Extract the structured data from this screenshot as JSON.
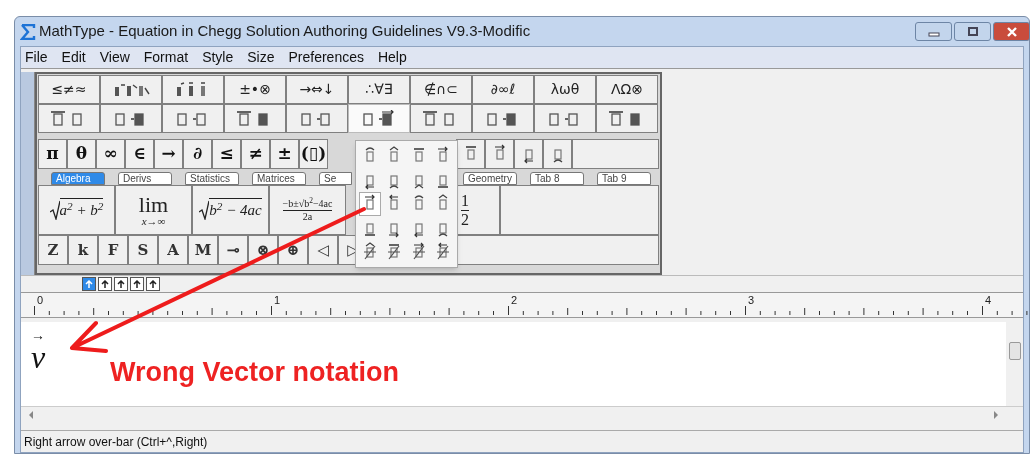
{
  "window": {
    "title": "MathType - Equation in Chegg Solution Authoring Guidelines V9.3-Modific"
  },
  "menu": [
    "File",
    "Edit",
    "View",
    "Format",
    "Style",
    "Size",
    "Preferences",
    "Help"
  ],
  "palette": {
    "row_1": [
      {
        "kind": "text",
        "text": "≤≠≈"
      },
      {
        "kind": "icon"
      },
      {
        "kind": "icon"
      },
      {
        "kind": "text",
        "text": "±•⊗"
      },
      {
        "kind": "text",
        "text": "→⇔↓"
      },
      {
        "kind": "text",
        "text": "∴∀∃"
      },
      {
        "kind": "text",
        "text": "∉∩⊂"
      },
      {
        "kind": "text",
        "text": "∂∞ℓ"
      },
      {
        "kind": "text",
        "text": "λωθ"
      },
      {
        "kind": "text",
        "text": "ΛΩ⊗"
      }
    ],
    "row_2": [
      {
        "selected": false
      },
      {
        "selected": false
      },
      {
        "selected": false
      },
      {
        "selected": false
      },
      {
        "selected": false
      },
      {
        "selected": true
      },
      {
        "selected": false
      },
      {
        "selected": false
      },
      {
        "selected": false
      },
      {
        "selected": false
      }
    ],
    "row_3": [
      "π",
      "θ",
      "∞",
      "∈",
      "→",
      "∂",
      "≤",
      "≠",
      "±",
      "(▯)"
    ],
    "tabs": [
      {
        "label": "Algebra",
        "selected": true
      },
      {
        "label": "Derivs",
        "selected": false
      },
      {
        "label": "Statistics",
        "selected": false
      },
      {
        "label": "Matrices",
        "selected": false
      },
      {
        "label": "Se",
        "selected": false
      },
      {
        "label": "Geometry",
        "selected": false
      },
      {
        "label": "Tab 8",
        "selected": false
      },
      {
        "label": "Tab 9",
        "selected": false
      }
    ],
    "expressions": [
      {
        "kind": "radical",
        "text": "a$^{2}$ + b$^{2}$"
      },
      {
        "kind": "limit",
        "top": "lim",
        "bottom": "x→∞"
      },
      {
        "kind": "radical",
        "text": "b$^{2}$ − 4ac"
      },
      {
        "kind": "fraction",
        "numerator": "−b±√b$^{2}$−4ac",
        "denominator": "2a"
      },
      {
        "kind": "fraction",
        "numerator": "1",
        "denominator": "2"
      }
    ],
    "row_5": [
      "Z",
      "k",
      "F",
      "S",
      "A",
      "M",
      "⊸",
      "⊗",
      "⊕",
      "◁",
      "▷"
    ]
  },
  "popup": {
    "items": [
      {
        "selected": false
      },
      {
        "selected": false
      },
      {
        "selected": false
      },
      {
        "selected": false
      },
      {
        "selected": false
      },
      {
        "selected": false
      },
      {
        "selected": false
      },
      {
        "selected": false
      },
      {
        "selected": true
      },
      {
        "selected": false
      },
      {
        "selected": false
      },
      {
        "selected": false
      },
      {
        "selected": false
      },
      {
        "selected": false
      },
      {
        "selected": false
      },
      {
        "selected": false
      },
      {
        "selected": false
      },
      {
        "selected": false
      },
      {
        "selected": false
      },
      {
        "selected": false
      }
    ]
  },
  "tab_icons": [
    {
      "selected": true
    },
    {
      "selected": false
    },
    {
      "selected": false
    },
    {
      "selected": false
    },
    {
      "selected": false
    }
  ],
  "ruler": [
    "0",
    "1",
    "2",
    "3",
    "4"
  ],
  "equation": {
    "base": "v",
    "accent": "→"
  },
  "annotation": {
    "text": "Wrong Vector notation"
  },
  "status_bar": "Right arrow over-bar (Ctrl+^,Right)"
}
